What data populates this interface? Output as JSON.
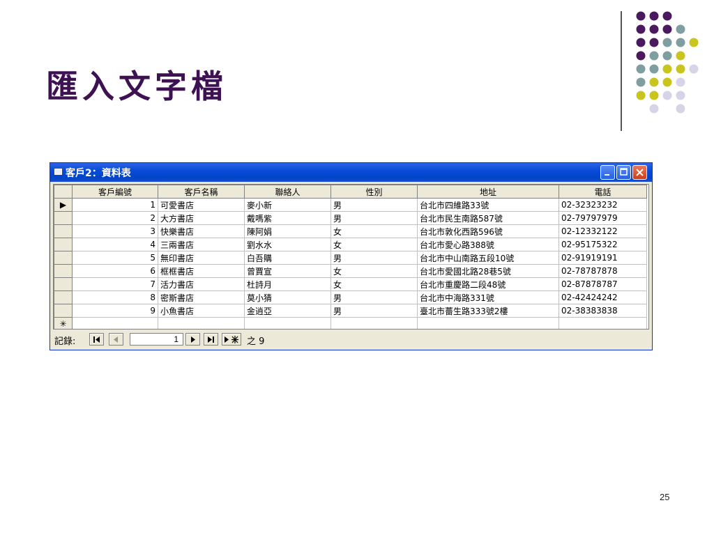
{
  "slide": {
    "title": "匯入文字檔",
    "page_number": "25"
  },
  "decor": {
    "dot_colors": {
      "purple": "#4b1a5e",
      "teal": "#7f9ea0",
      "yellow": "#c9c41e",
      "lavender": "#d6d4e6"
    }
  },
  "window": {
    "title": "客戶2：資料表",
    "controls": [
      "minimize",
      "maximize",
      "close"
    ]
  },
  "table": {
    "columns": [
      "客戶編號",
      "客戶名稱",
      "聯絡人",
      "性別",
      "地址",
      "電話"
    ],
    "rows": [
      [
        "1",
        "可愛書店",
        "麥小新",
        "男",
        "台北市四維路33號",
        "02-32323232"
      ],
      [
        "2",
        "大方書店",
        "戴嗎紫",
        "男",
        "台北市民生南路587號",
        "02-79797979"
      ],
      [
        "3",
        "快樂書店",
        "陳阿娟",
        "女",
        "台北市敦化西路596號",
        "02-12332122"
      ],
      [
        "4",
        "三兩書店",
        "劉水水",
        "女",
        "台北市愛心路388號",
        "02-95175322"
      ],
      [
        "5",
        "無印書店",
        "白吾購",
        "男",
        "台北市中山南路五段10號",
        "02-91919191"
      ],
      [
        "6",
        "框框書店",
        "曾賈宣",
        "女",
        "台北市愛國北路28巷5號",
        "02-78787878"
      ],
      [
        "7",
        "活力書店",
        "杜詩月",
        "女",
        "台北市重慶路二段48號",
        "02-87878787"
      ],
      [
        "8",
        "密斯書店",
        "莫小猜",
        "男",
        "台北市中海路331號",
        "02-42424242"
      ],
      [
        "9",
        "小魚書店",
        "金逍亞",
        "男",
        "臺北市薔生路333號2樓",
        "02-38383838"
      ]
    ],
    "new_row_marker": "✳",
    "current_row_marker": "▶"
  },
  "navigation": {
    "label": "記錄:",
    "current_record": "1",
    "of_text": "之 9"
  }
}
